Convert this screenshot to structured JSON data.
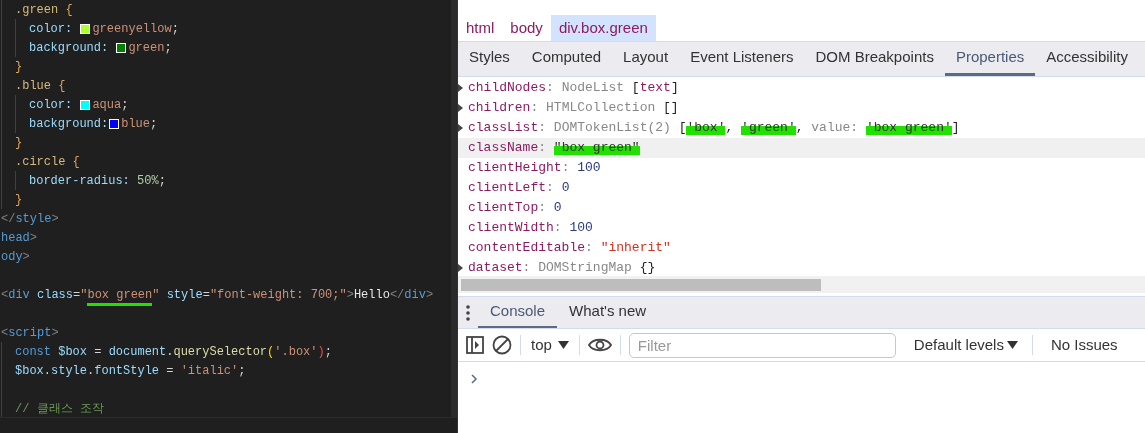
{
  "editor": {
    "lines": [
      {
        "kind": "group",
        "children": [
          {
            "kind": "code",
            "tokens": [
              {
                "text": ".green",
                "kind": "selector"
              },
              {
                "text": " {",
                "kind": "brace"
              }
            ],
            "children": [
              {
                "kind": "code",
                "tokens": [
                  {
                    "text": "color: ",
                    "kind": "property"
                  },
                  {
                    "kind": "swatch",
                    "color": "#adff2f"
                  },
                  {
                    "text": "greenyellow",
                    "kind": "value"
                  },
                  {
                    "text": ";",
                    "kind": "punct"
                  }
                ]
              },
              {
                "kind": "code",
                "tokens": [
                  {
                    "text": "background: ",
                    "kind": "property"
                  },
                  {
                    "kind": "swatch",
                    "color": "#008000"
                  },
                  {
                    "text": "green",
                    "kind": "value"
                  },
                  {
                    "text": ";",
                    "kind": "punct"
                  }
                ]
              }
            ]
          },
          {
            "kind": "code",
            "tokens": [
              {
                "text": "}",
                "kind": "brace"
              }
            ]
          },
          {
            "kind": "code",
            "tokens": [
              {
                "text": ".blue",
                "kind": "selector"
              },
              {
                "text": " {",
                "kind": "brace"
              }
            ],
            "children": [
              {
                "kind": "code",
                "tokens": [
                  {
                    "text": "color: ",
                    "kind": "property"
                  },
                  {
                    "kind": "swatch",
                    "color": "#00ffff"
                  },
                  {
                    "text": "aqua",
                    "kind": "value"
                  },
                  {
                    "text": ";",
                    "kind": "punct"
                  }
                ]
              },
              {
                "kind": "code",
                "tokens": [
                  {
                    "text": "background:",
                    "kind": "property"
                  },
                  {
                    "kind": "swatch",
                    "color": "#0000ff"
                  },
                  {
                    "text": "blue",
                    "kind": "value"
                  },
                  {
                    "text": ";",
                    "kind": "punct"
                  }
                ]
              }
            ]
          },
          {
            "kind": "code",
            "tokens": [
              {
                "text": "}",
                "kind": "brace"
              }
            ]
          },
          {
            "kind": "code",
            "tokens": [
              {
                "text": ".circle",
                "kind": "selector"
              },
              {
                "text": " {",
                "kind": "brace"
              }
            ],
            "children": [
              {
                "kind": "code",
                "tokens": [
                  {
                    "text": "border-radius: ",
                    "kind": "property"
                  },
                  {
                    "text": "50%",
                    "kind": "number"
                  },
                  {
                    "text": ";",
                    "kind": "punct"
                  }
                ]
              }
            ]
          },
          {
            "kind": "code",
            "tokens": [
              {
                "text": "}",
                "kind": "brace"
              }
            ]
          }
        ]
      },
      {
        "kind": "code",
        "tokens": [
          {
            "text": "</",
            "kind": "bracket"
          },
          {
            "text": "style",
            "kind": "tag"
          },
          {
            "text": ">",
            "kind": "bracket"
          }
        ]
      },
      {
        "kind": "code",
        "tokens": [
          {
            "text": "head",
            "kind": "tag"
          },
          {
            "text": ">",
            "kind": "bracket"
          }
        ]
      },
      {
        "kind": "code",
        "tokens": [
          {
            "text": "ody",
            "kind": "tag"
          },
          {
            "text": ">",
            "kind": "bracket"
          }
        ]
      },
      {
        "kind": "blank"
      },
      {
        "kind": "code",
        "tokens": [
          {
            "text": "<",
            "kind": "bracket"
          },
          {
            "text": "div",
            "kind": "tag"
          },
          {
            "text": " class",
            "kind": "attr"
          },
          {
            "text": "=",
            "kind": "punct"
          },
          {
            "text": "\"",
            "kind": "string"
          },
          {
            "text": "box green",
            "kind": "string",
            "marked": true
          },
          {
            "text": "\"",
            "kind": "string"
          },
          {
            "text": " style",
            "kind": "attr"
          },
          {
            "text": "=",
            "kind": "punct"
          },
          {
            "text": "\"font-weight: 700;\"",
            "kind": "string"
          },
          {
            "text": ">",
            "kind": "bracket"
          },
          {
            "text": "Hello",
            "kind": "text"
          },
          {
            "text": "</",
            "kind": "bracket"
          },
          {
            "text": "div",
            "kind": "tag"
          },
          {
            "text": ">",
            "kind": "bracket"
          }
        ]
      },
      {
        "kind": "blank"
      },
      {
        "kind": "code",
        "tokens": [
          {
            "text": "<",
            "kind": "bracket"
          },
          {
            "text": "script",
            "kind": "tag"
          },
          {
            "text": ">",
            "kind": "bracket"
          }
        ],
        "children": [
          {
            "kind": "code",
            "tokens": [
              {
                "text": "const",
                "kind": "keyword"
              },
              {
                "text": " $box",
                "kind": "variable"
              },
              {
                "text": " = ",
                "kind": "punct"
              },
              {
                "text": "document",
                "kind": "variable"
              },
              {
                "text": ".",
                "kind": "punct"
              },
              {
                "text": "querySelector",
                "kind": "function"
              },
              {
                "text": "(",
                "kind": "paren"
              },
              {
                "text": "'.box'",
                "kind": "string"
              },
              {
                "text": ")",
                "kind": "paren-error"
              },
              {
                "text": ";",
                "kind": "punct"
              }
            ]
          },
          {
            "kind": "code",
            "tokens": [
              {
                "text": "$box",
                "kind": "variable"
              },
              {
                "text": ".",
                "kind": "punct"
              },
              {
                "text": "style",
                "kind": "variable"
              },
              {
                "text": ".",
                "kind": "punct"
              },
              {
                "text": "fontStyle",
                "kind": "variable"
              },
              {
                "text": " = ",
                "kind": "punct"
              },
              {
                "text": "'italic'",
                "kind": "string"
              },
              {
                "text": ";",
                "kind": "punct"
              }
            ]
          },
          {
            "kind": "blank"
          },
          {
            "kind": "code",
            "tokens": [
              {
                "text": "// 클래스 조작",
                "kind": "comment"
              }
            ]
          }
        ]
      }
    ]
  },
  "devtools": {
    "breadcrumbs": [
      {
        "label": "html",
        "selected": false
      },
      {
        "label": "body",
        "selected": false
      },
      {
        "label": "div.box.green",
        "selected": true
      }
    ],
    "tabs": [
      {
        "label": "Styles",
        "selected": false
      },
      {
        "label": "Computed",
        "selected": false
      },
      {
        "label": "Layout",
        "selected": false
      },
      {
        "label": "Event Listeners",
        "selected": false
      },
      {
        "label": "DOM Breakpoints",
        "selected": false
      },
      {
        "label": "Properties",
        "selected": true
      },
      {
        "label": "Accessibility",
        "selected": false
      }
    ],
    "properties": [
      {
        "name": "childNodes",
        "expandable": true,
        "selected": false,
        "value": [
          {
            "text": ": ",
            "kind": "colon"
          },
          {
            "text": "NodeList",
            "kind": "type"
          },
          {
            "text": " [",
            "kind": "punct"
          },
          {
            "text": "text",
            "kind": "node"
          },
          {
            "text": "]",
            "kind": "punct"
          }
        ]
      },
      {
        "name": "children",
        "expandable": true,
        "selected": false,
        "value": [
          {
            "text": ": ",
            "kind": "colon"
          },
          {
            "text": "HTMLCollection",
            "kind": "type"
          },
          {
            "text": " []",
            "kind": "punct"
          }
        ]
      },
      {
        "name": "classList",
        "expandable": true,
        "selected": false,
        "value": [
          {
            "text": ": ",
            "kind": "colon"
          },
          {
            "text": "DOMTokenList(2)",
            "kind": "type"
          },
          {
            "text": " [",
            "kind": "punct"
          },
          {
            "text": "'box'",
            "kind": "string",
            "marked": true
          },
          {
            "text": ", ",
            "kind": "punct"
          },
          {
            "text": "'green'",
            "kind": "string",
            "marked": true
          },
          {
            "text": ", ",
            "kind": "punct"
          },
          {
            "text": "value: ",
            "kind": "type"
          },
          {
            "text": "'box green'",
            "kind": "string",
            "marked": true
          },
          {
            "text": "]",
            "kind": "punct"
          }
        ]
      },
      {
        "name": "className",
        "expandable": false,
        "selected": true,
        "value": [
          {
            "text": ": ",
            "kind": "colon"
          },
          {
            "text": "\"box green\"",
            "kind": "string",
            "marked": true
          }
        ]
      },
      {
        "name": "clientHeight",
        "expandable": false,
        "selected": false,
        "value": [
          {
            "text": ": ",
            "kind": "colon"
          },
          {
            "text": "100",
            "kind": "number"
          }
        ]
      },
      {
        "name": "clientLeft",
        "expandable": false,
        "selected": false,
        "value": [
          {
            "text": ": ",
            "kind": "colon"
          },
          {
            "text": "0",
            "kind": "number"
          }
        ]
      },
      {
        "name": "clientTop",
        "expandable": false,
        "selected": false,
        "value": [
          {
            "text": ": ",
            "kind": "colon"
          },
          {
            "text": "0",
            "kind": "number"
          }
        ]
      },
      {
        "name": "clientWidth",
        "expandable": false,
        "selected": false,
        "value": [
          {
            "text": ": ",
            "kind": "colon"
          },
          {
            "text": "100",
            "kind": "number"
          }
        ]
      },
      {
        "name": "contentEditable",
        "expandable": false,
        "selected": false,
        "value": [
          {
            "text": ": ",
            "kind": "colon"
          },
          {
            "text": "\"inherit\"",
            "kind": "string"
          }
        ]
      },
      {
        "name": "dataset",
        "expandable": true,
        "selected": false,
        "value": [
          {
            "text": ": ",
            "kind": "colon"
          },
          {
            "text": "DOMStringMap",
            "kind": "type"
          },
          {
            "text": " {}",
            "kind": "punct"
          }
        ]
      }
    ],
    "drawer_tabs": [
      {
        "label": "Console",
        "selected": true
      },
      {
        "label": "What's new",
        "selected": false
      }
    ],
    "console_toolbar": {
      "context": "top",
      "filter": {
        "placeholder": "Filter"
      },
      "levels": "Default levels",
      "issues": "No Issues"
    }
  }
}
